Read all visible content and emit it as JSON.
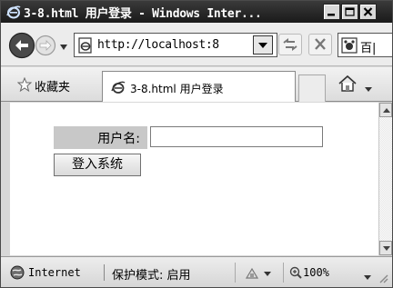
{
  "window": {
    "title": "3-8.html 用户登录 - Windows Inter..."
  },
  "nav": {
    "address": "http://localhost:8",
    "search_provider_text": "百|"
  },
  "favorites": {
    "label": "收藏夹"
  },
  "tab": {
    "title": "3-8.html 用户登录"
  },
  "form": {
    "username_label": "用户名:",
    "username_value": "",
    "login_button": "登入系统"
  },
  "status": {
    "zone": "Internet",
    "protected_mode": "保护模式: 启用",
    "zoom": "100%"
  },
  "icons": {
    "browser": "ie-icon",
    "back": "back-arrow-icon",
    "forward": "forward-arrow-icon",
    "refresh": "refresh-icon",
    "stop": "stop-icon",
    "favorites": "star-icon",
    "home": "home-icon",
    "globe": "globe-icon",
    "zoom": "magnifier-icon"
  }
}
